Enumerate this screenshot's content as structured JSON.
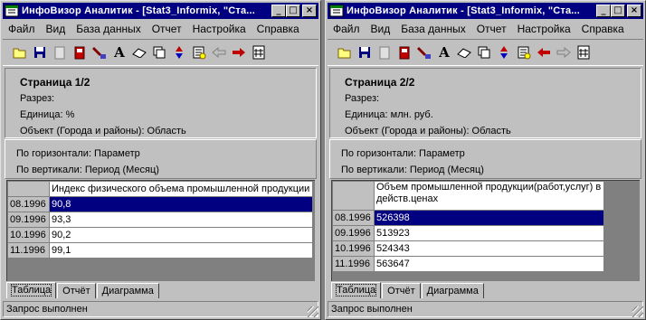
{
  "windows": [
    {
      "title": "ИнфоВизор Аналитик - [Stat3_Informix, \"Ста...",
      "menu": [
        "Файл",
        "Вид",
        "База данных",
        "Отчет",
        "Настройка",
        "Справка"
      ],
      "info": {
        "page": "Страница 1/2",
        "section": "Разрез:",
        "unit": "Единица: %",
        "object": "Объект (Города и районы): Область"
      },
      "axes": {
        "horizontal": "По горизонтали: Параметр",
        "vertical": "По вертикали: Период (Месяц)"
      },
      "grid": {
        "column_header": "Индекс физического объема промышленной продукции",
        "rows": [
          {
            "period": "08.1996",
            "value": "90,8"
          },
          {
            "period": "09.1996",
            "value": "93,3"
          },
          {
            "period": "10.1996",
            "value": "90,2"
          },
          {
            "period": "11.1996",
            "value": "99,1"
          }
        ],
        "selected_row": 0
      },
      "tabs": [
        "Таблица",
        "Отчёт",
        "Диаграмма"
      ],
      "active_tab": 0,
      "status": "Запрос выполнен"
    },
    {
      "title": "ИнфоВизор Аналитик - [Stat3_Informix, \"Ста...",
      "menu": [
        "Файл",
        "Вид",
        "База данных",
        "Отчет",
        "Настройка",
        "Справка"
      ],
      "info": {
        "page": "Страница 2/2",
        "section": "Разрез:",
        "unit": "Единица: млн. руб.",
        "object": "Объект (Города и районы): Область"
      },
      "axes": {
        "horizontal": "По горизонтали: Параметр",
        "vertical": "По вертикали: Период (Месяц)"
      },
      "grid": {
        "column_header": "Объем промышленной продукции(работ,услуг) в действ.ценах",
        "rows": [
          {
            "period": "08.1996",
            "value": "526398"
          },
          {
            "period": "09.1996",
            "value": "513923"
          },
          {
            "period": "10.1996",
            "value": "524343"
          },
          {
            "period": "11.1996",
            "value": "563647"
          }
        ],
        "selected_row": 0
      },
      "tabs": [
        "Таблица",
        "Отчёт",
        "Диаграмма"
      ],
      "active_tab": 0,
      "status": "Запрос выполнен"
    }
  ],
  "title_buttons": {
    "minimize": "_",
    "maximize": "□",
    "close": "×"
  },
  "toolbar_icons": [
    "open-folder-icon",
    "save-icon",
    "document-icon",
    "database-icon",
    "filter-icon",
    "font-icon",
    "eraser-icon",
    "copy-icon",
    "sort-icon",
    "properties-icon",
    "back-arrow-icon",
    "forward-arrow-icon",
    "pivot-icon"
  ],
  "colors": {
    "titlebar": "#000080",
    "selection": "#000080",
    "face": "#c0c0c0",
    "arrow": "#c00000"
  }
}
